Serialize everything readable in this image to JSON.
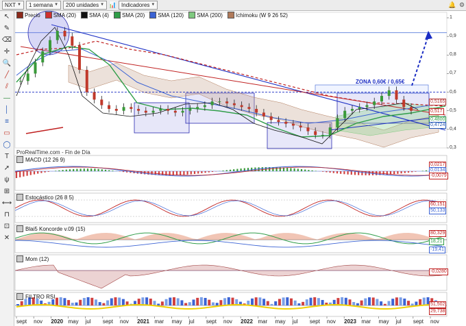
{
  "toolbar": {
    "ticker": "NXT",
    "period": "1 semana",
    "units": "200 unidades",
    "indicators": "Indicadores"
  },
  "legend": [
    {
      "label": "Precio",
      "color": "#8c2a1b"
    },
    {
      "label": "SMA (20)",
      "color": "#d03030"
    },
    {
      "label": "SMA (4)",
      "color": "#111111"
    },
    {
      "label": "SMA (20)",
      "color": "#2f9d48"
    },
    {
      "label": "SMA (120)",
      "color": "#3b63d4"
    },
    {
      "label": "SMA (200)",
      "color": "#7fc97f"
    },
    {
      "label": "Ichimoku (W 9 26 52)",
      "color": "#b07a5a"
    }
  ],
  "source_text": "ProRealTime.com - Fin de Día",
  "annotation_zone": "ZONA 0,60€ / 0,65€",
  "panels": {
    "macd": "MACD (12 26 9)",
    "stoch": "Estocástico (26 8 5)",
    "blai5": "Blai5 Koncorde v.09 (15)",
    "mom": "Mom (12)",
    "rsi": "FILTRO RSI"
  },
  "price_labels": [
    {
      "text": "0,5165",
      "color": "#b03030"
    },
    {
      "text": "0,517",
      "color": "#c0201e"
    },
    {
      "text": "0,4800",
      "color": "#2f9d48"
    },
    {
      "text": "0,4724",
      "color": "#2155b5"
    }
  ],
  "indicator_labels": {
    "macd": [
      "0,0217",
      "0,0134",
      "-0,0079"
    ],
    "stoch": [
      "60,151",
      "50,133"
    ],
    "blai5": [
      "80,329",
      "18,21",
      "-19,41"
    ],
    "mom": [
      "-0,0280"
    ],
    "rsi": [
      "51,502",
      "29,738"
    ]
  },
  "chart_data": {
    "type": "line",
    "title": "",
    "xlabel": "",
    "ylabel": "",
    "ylim": [
      0.3,
      1.0
    ],
    "y_ticks": [
      "1",
      "0,9",
      "0,8",
      "0,7",
      "0,6",
      "0,5",
      "0,4",
      "0,3"
    ],
    "x_ticks": [
      {
        "label": "sept",
        "bold": false
      },
      {
        "label": "nov",
        "bold": false
      },
      {
        "label": "2020",
        "bold": true
      },
      {
        "label": "may",
        "bold": false
      },
      {
        "label": "jul",
        "bold": false
      },
      {
        "label": "sept",
        "bold": false
      },
      {
        "label": "nov",
        "bold": false
      },
      {
        "label": "2021",
        "bold": true
      },
      {
        "label": "mar",
        "bold": false
      },
      {
        "label": "may",
        "bold": false
      },
      {
        "label": "jul",
        "bold": false
      },
      {
        "label": "sept",
        "bold": false
      },
      {
        "label": "nov",
        "bold": false
      },
      {
        "label": "2022",
        "bold": true
      },
      {
        "label": "mar",
        "bold": false
      },
      {
        "label": "may",
        "bold": false
      },
      {
        "label": "jul",
        "bold": false
      },
      {
        "label": "sept",
        "bold": false
      },
      {
        "label": "nov",
        "bold": false
      },
      {
        "label": "2023",
        "bold": true
      },
      {
        "label": "mar",
        "bold": false
      },
      {
        "label": "may",
        "bold": false
      },
      {
        "label": "jul",
        "bold": false
      },
      {
        "label": "sept",
        "bold": false
      },
      {
        "label": "nov",
        "bold": false
      }
    ],
    "price_series": [
      0.66,
      0.7,
      0.76,
      0.82,
      0.88,
      0.93,
      0.9,
      0.85,
      0.72,
      0.6,
      0.56,
      0.53,
      0.51,
      0.5,
      0.52,
      0.51,
      0.5,
      0.49,
      0.5,
      0.51,
      0.5,
      0.49,
      0.5,
      0.51,
      0.52,
      0.53,
      0.55,
      0.55,
      0.54,
      0.53,
      0.52,
      0.51,
      0.49,
      0.47,
      0.45,
      0.44,
      0.43,
      0.42,
      0.41,
      0.39,
      0.37,
      0.37,
      0.41,
      0.46,
      0.5,
      0.51,
      0.52,
      0.53,
      0.55,
      0.58,
      0.61,
      0.56,
      0.52,
      0.5
    ],
    "horizontal_levels": [
      {
        "y": 0.92,
        "color": "#3b63d4"
      },
      {
        "y": 0.6,
        "color": "#1a2dc4"
      }
    ]
  }
}
